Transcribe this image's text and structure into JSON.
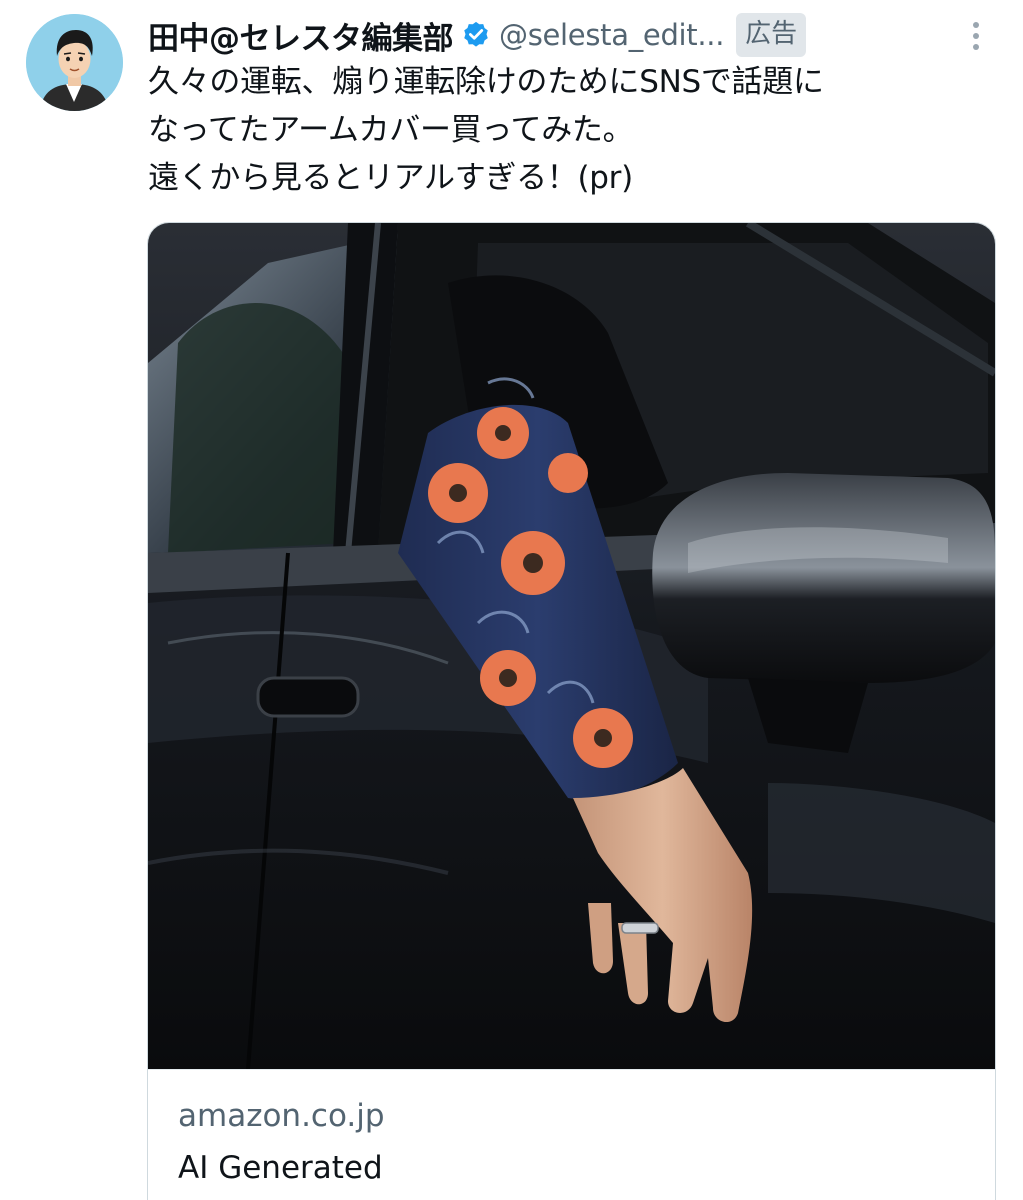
{
  "tweet": {
    "display_name": "田中@セレスタ編集部",
    "handle": "@selesta_edit...",
    "ad_label": "広告",
    "text": "久々の運転、煽り運転除けのためにSNSで話題に\nなってたアームカバー買ってみた。\n遠くから見るとリアルすぎる！(pr)"
  },
  "card": {
    "domain": "amazon.co.jp",
    "title": "AI Generated"
  },
  "icons": {
    "verified": "verified-badge-icon",
    "more": "more-options-icon"
  },
  "colors": {
    "verified_blue": "#1d9bf0",
    "secondary_text": "#536471",
    "primary_text": "#0f1419",
    "badge_bg": "#e1e6ea"
  }
}
